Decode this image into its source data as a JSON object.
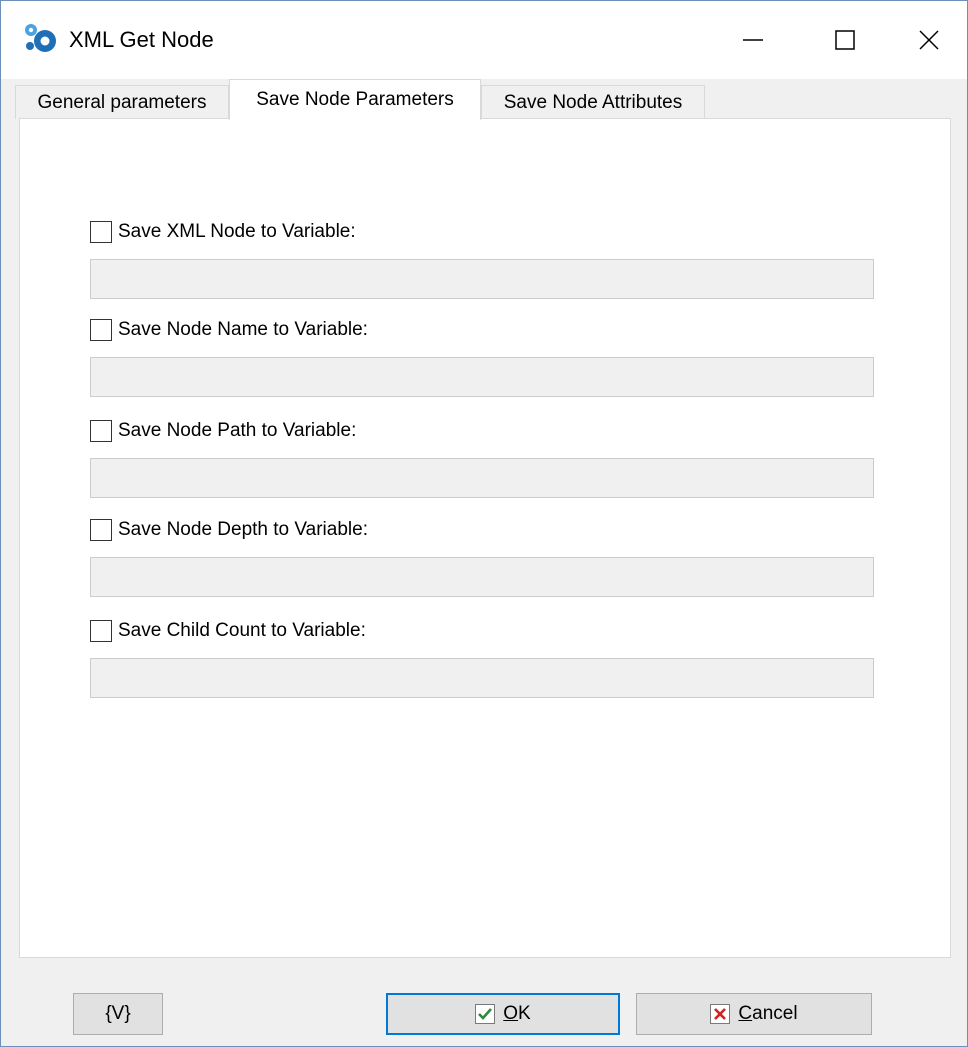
{
  "window": {
    "title": "XML Get Node",
    "controls": {
      "minimize": "minimize",
      "maximize": "maximize",
      "close": "close"
    }
  },
  "tabs": [
    {
      "label": "General parameters",
      "active": false
    },
    {
      "label": "Save Node Parameters",
      "active": true
    },
    {
      "label": "Save Node Attributes",
      "active": false
    }
  ],
  "fields": [
    {
      "label": "Save XML Node to Variable:",
      "checked": false,
      "value": ""
    },
    {
      "label": "Save Node Name to Variable:",
      "checked": false,
      "value": ""
    },
    {
      "label": "Save Node Path to Variable:",
      "checked": false,
      "value": ""
    },
    {
      "label": "Save Node Depth to Variable:",
      "checked": false,
      "value": ""
    },
    {
      "label": "Save Child Count to Variable:",
      "checked": false,
      "value": ""
    }
  ],
  "buttons": {
    "variables": "{V}",
    "ok_first": "O",
    "ok_rest": "K",
    "cancel_first": "C",
    "cancel_rest": "ancel"
  },
  "colors": {
    "accent": "#0078d7",
    "ok_check": "#2e8b3a",
    "cancel_x": "#d32020",
    "app_icon": "#1e6fb8"
  },
  "icons": {
    "app": "xml-gears-icon",
    "ok": "checkmark-icon",
    "cancel": "x-icon"
  }
}
